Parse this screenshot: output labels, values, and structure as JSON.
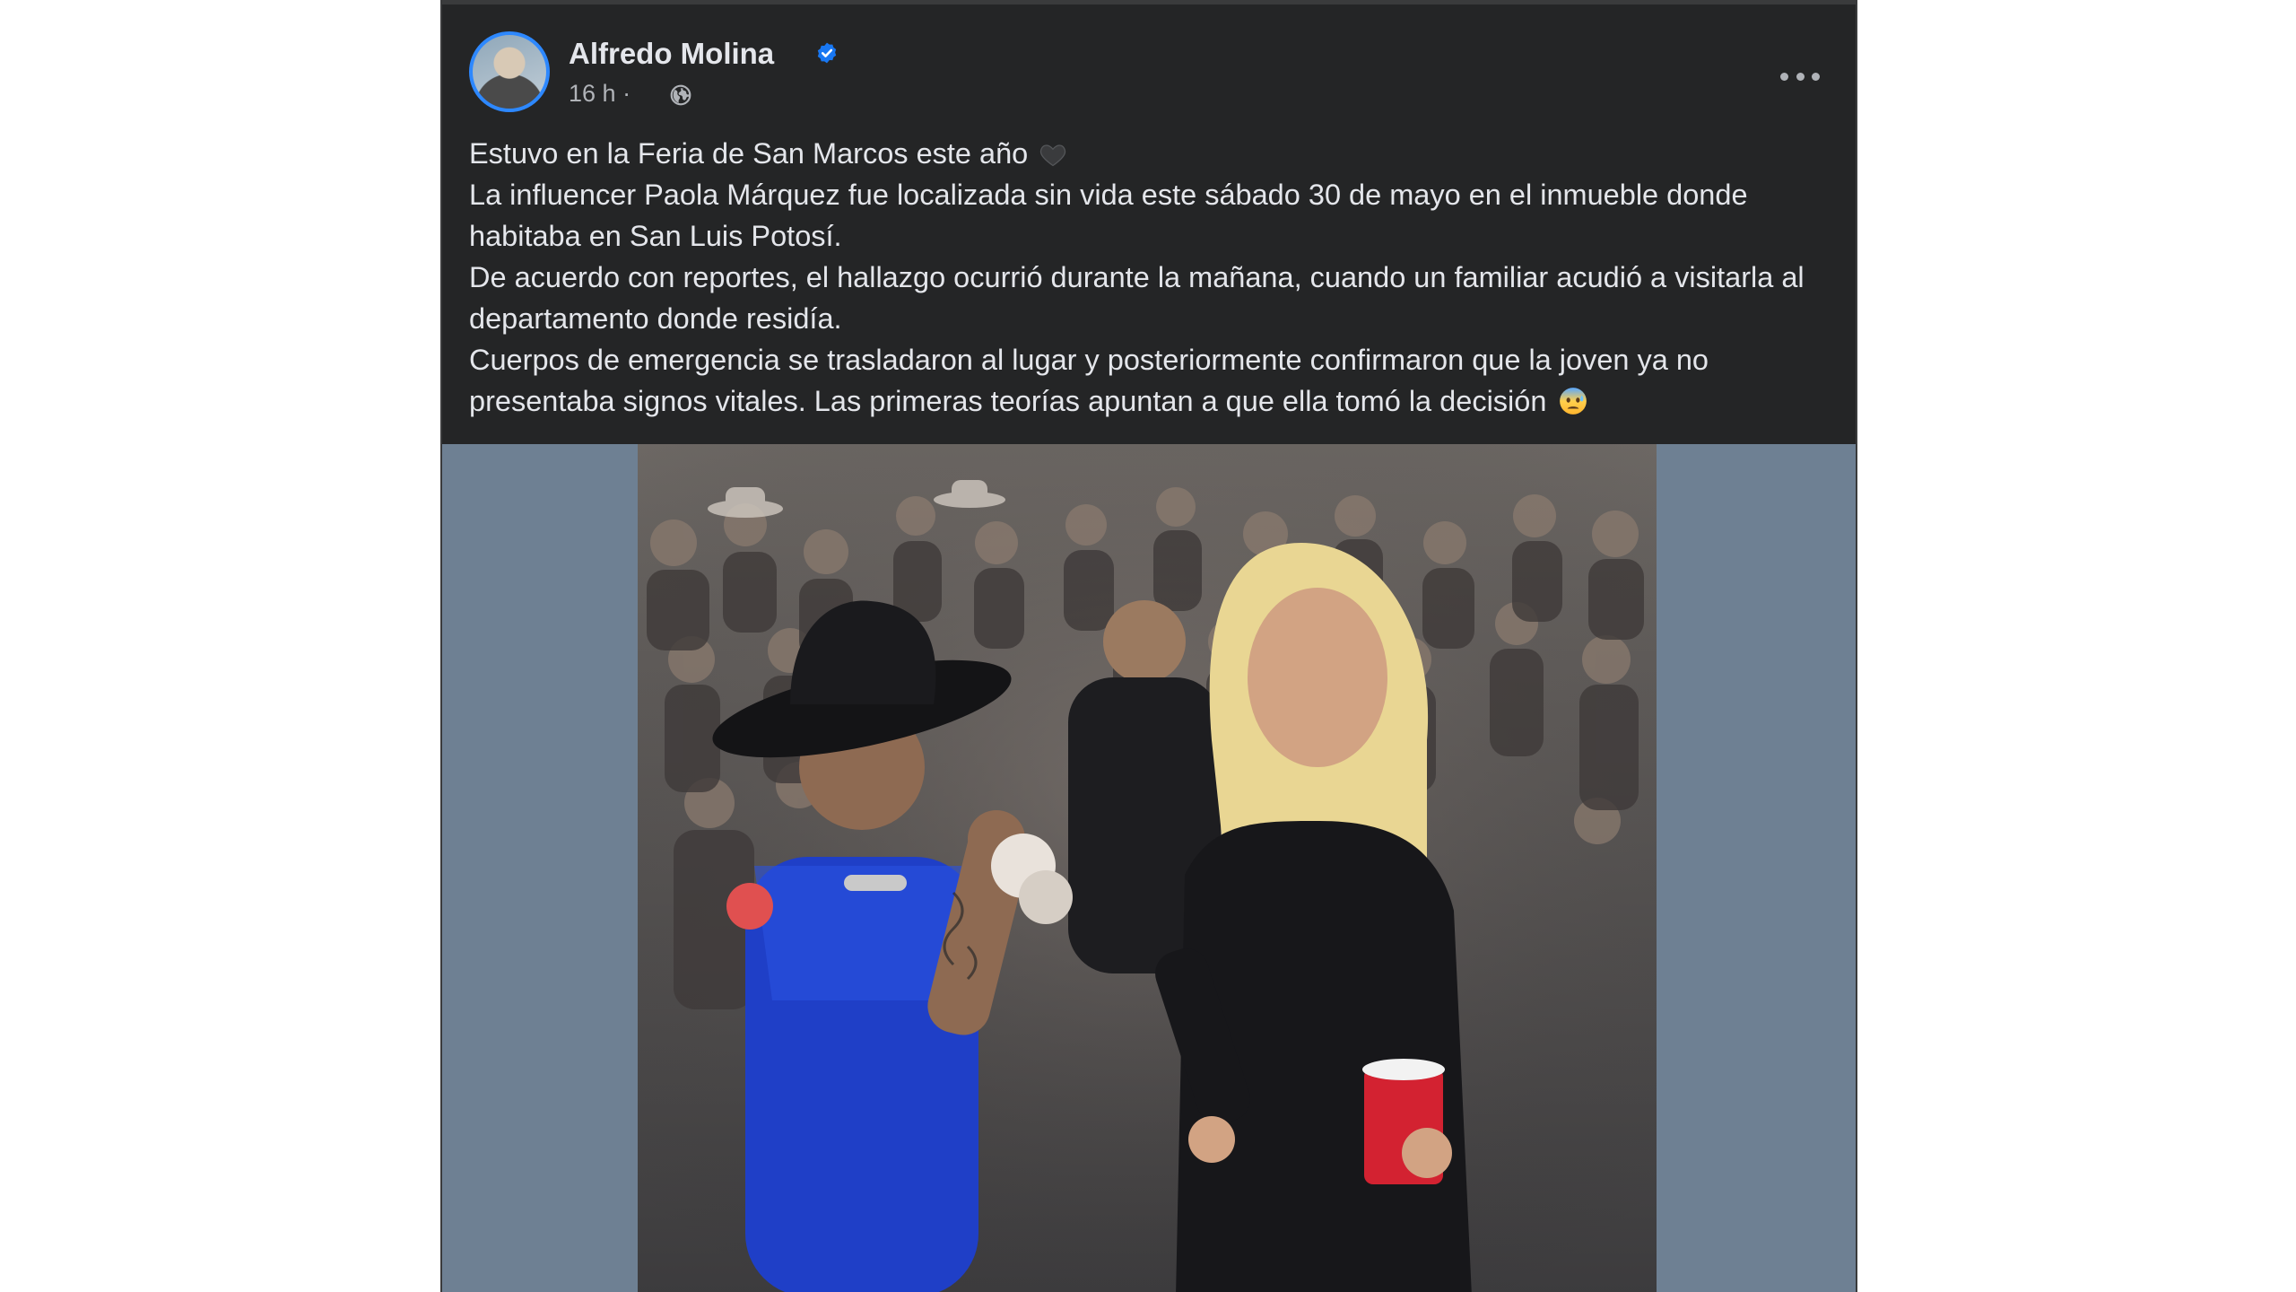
{
  "post": {
    "author": "Alfredo Molina",
    "timestamp": "16 h",
    "separator": "·",
    "verified_icon": "verified-badge-icon",
    "audience_icon": "globe-icon",
    "more_icon": "more-options-icon",
    "lines": [
      "Estuvo en la Feria de San Marcos este año",
      "La influencer Paola Márquez fue localizada sin vida este sábado 30 de mayo en el inmueble donde habitaba en San Luis Potosí.",
      "De acuerdo con reportes, el hallazgo ocurrió durante la mañana, cuando un familiar acudió a visitarla al departamento donde residía.",
      "Cuerpos de emergencia se trasladaron al lugar y posteriormente confirmaron que la joven ya no presentaba signos vitales. Las primeras teorías apuntan a que ella tomó la decisión"
    ],
    "emojis": [
      "black-heart-emoji",
      "anxious-face-emoji"
    ]
  },
  "colors": {
    "card_background": "#242526",
    "text_primary": "#e4e6eb",
    "text_secondary": "#b0b3b8",
    "verified_blue": "#1877f2",
    "media_background": "#6e8093"
  }
}
